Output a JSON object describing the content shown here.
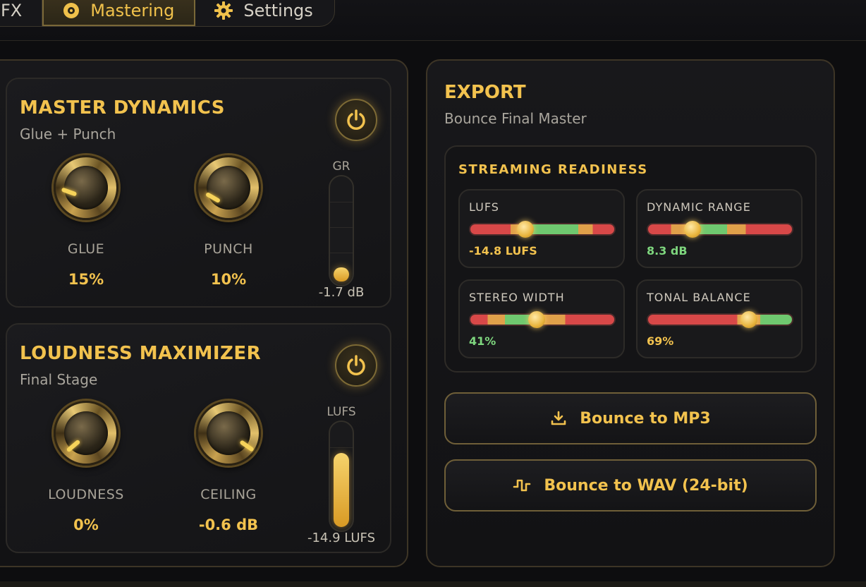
{
  "tabs": [
    {
      "label": "FX",
      "icon": "",
      "active": false
    },
    {
      "label": "Mastering",
      "icon": "disc-icon",
      "active": true
    },
    {
      "label": "Settings",
      "icon": "gear-icon",
      "active": false
    }
  ],
  "dynamics": {
    "title": "MASTER DYNAMICS",
    "subtitle": "Glue + Punch",
    "knobs": [
      {
        "label": "GLUE",
        "value": "15%"
      },
      {
        "label": "PUNCH",
        "value": "10%"
      }
    ],
    "meter": {
      "label": "GR",
      "value": "-1.7 dB",
      "fill_fraction": 0.08
    }
  },
  "loudness": {
    "title": "LOUDNESS MAXIMIZER",
    "subtitle": "Final Stage",
    "knobs": [
      {
        "label": "LOUDNESS",
        "value": "0%"
      },
      {
        "label": "CEILING",
        "value": "-0.6 dB"
      }
    ],
    "meter": {
      "label": "LUFS",
      "value": "-14.9 LUFS",
      "fill_fraction": 0.73
    }
  },
  "export": {
    "title": "EXPORT",
    "subtitle": "Bounce Final Master",
    "readiness_title": "STREAMING READINESS",
    "metrics": [
      {
        "name": "LUFS",
        "value": "-14.8 LUFS",
        "position": 0.38,
        "value_color": "#f2c24e"
      },
      {
        "name": "DYNAMIC RANGE",
        "value": "8.3 dB",
        "position": 0.31,
        "value_color": "#7ed67e"
      },
      {
        "name": "STEREO WIDTH",
        "value": "41%",
        "position": 0.46,
        "value_color": "#7ed67e"
      },
      {
        "name": "TONAL BALANCE",
        "value": "69%",
        "position": 0.7,
        "value_color": "#f2c24e"
      }
    ],
    "buttons": [
      {
        "label": "Bounce to MP3",
        "icon": "download-icon"
      },
      {
        "label": "Bounce to WAV (24-bit)",
        "icon": "waveform-icon"
      }
    ]
  },
  "colors": {
    "accent": "#f2c24e",
    "good": "#7ed67e",
    "bad": "#e05555",
    "warn": "#e0a04a"
  }
}
